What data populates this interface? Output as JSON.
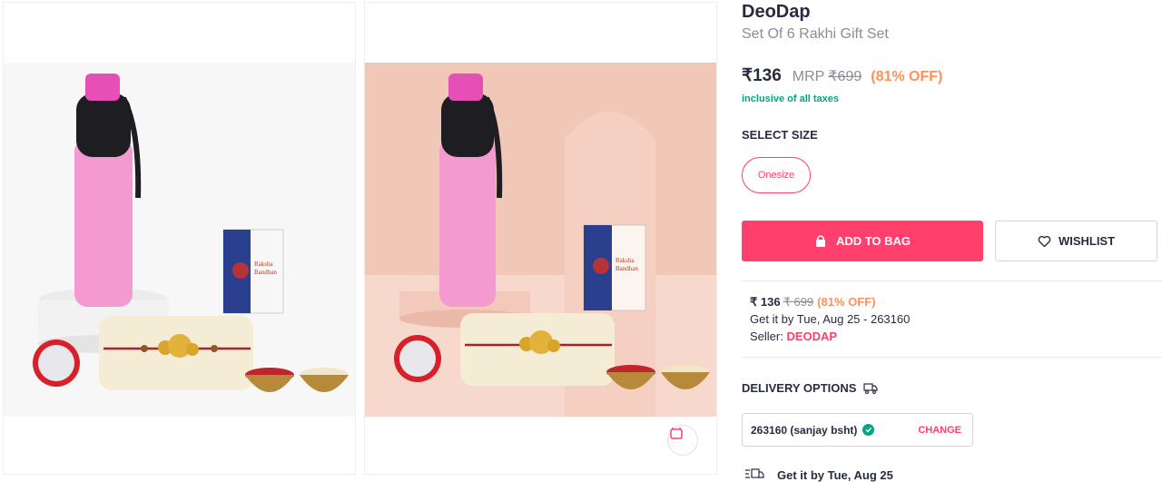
{
  "product": {
    "brand": "DeoDap",
    "name": "Set Of 6 Rakhi Gift Set",
    "price": "₹136",
    "mrp_label": "MRP",
    "mrp": "₹699",
    "discount": "(81% OFF)",
    "tax_note": "inclusive of all taxes"
  },
  "size": {
    "title": "SELECT SIZE",
    "options": [
      "Onesize"
    ]
  },
  "actions": {
    "add_to_bag": "ADD TO BAG",
    "wishlist": "WISHLIST"
  },
  "seller": {
    "price": "₹ 136",
    "mrp": "₹ 699",
    "discount": "(81% OFF)",
    "delivery": "Get it by Tue, Aug 25 - 263160",
    "seller_label": "Seller:",
    "seller_name": "DEODAP"
  },
  "delivery": {
    "title": "DELIVERY OPTIONS",
    "pincode": "263160 (sanjay bsht)",
    "change_label": "CHANGE",
    "get_it_by": "Get it by Tue, Aug 25"
  },
  "images": [
    {
      "alt": "Rakhi gift set with pink bottle"
    },
    {
      "alt": "Rakhi gift set with pink bottle on peach background"
    }
  ],
  "icons": [
    "bag-icon",
    "heart-icon",
    "truck-icon",
    "check-icon",
    "similar-icon",
    "delivery-truck-icon"
  ],
  "colors": {
    "accent": "#ff3f6c",
    "discount": "#ff905a",
    "success": "#03a685",
    "text": "#282c3f",
    "muted": "#8b8d97"
  }
}
